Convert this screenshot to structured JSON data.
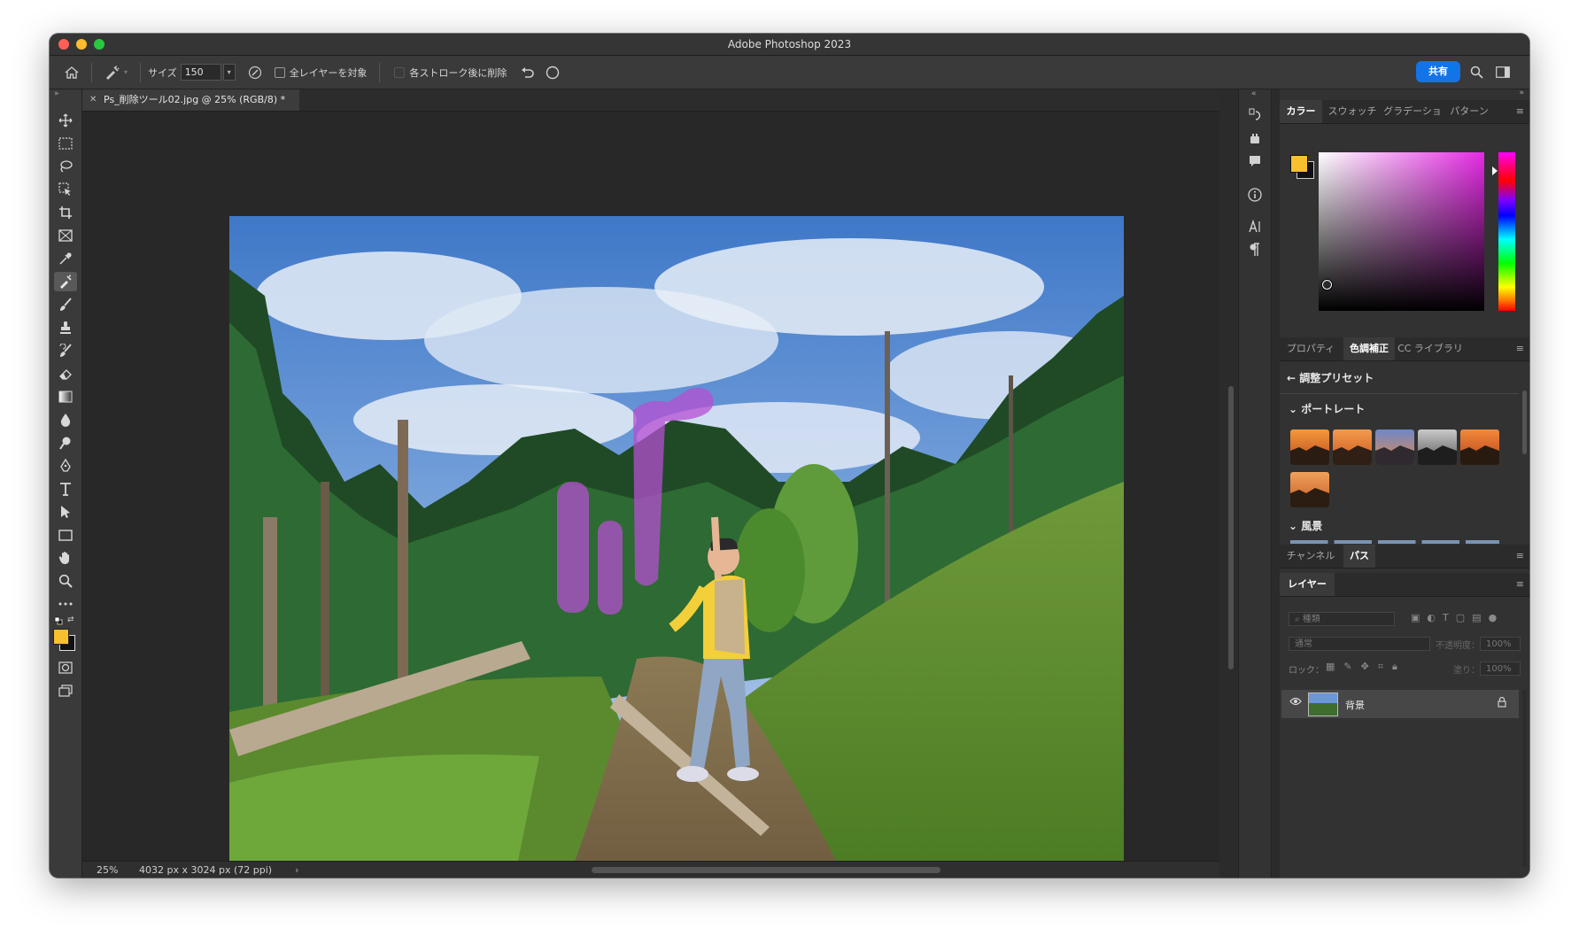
{
  "app": {
    "title": "Adobe Photoshop 2023"
  },
  "options": {
    "size_label": "サイズ",
    "size_value": "150",
    "all_layers_label": "全レイヤーを対象",
    "remove_after_stroke_label": "各ストローク後に削除",
    "share_label": "共有"
  },
  "document": {
    "tab_title": "Ps_削除ツール02.jpg @ 25% (RGB/8) *",
    "zoom": "25%",
    "dimensions": "4032 px x 3024 px (72 ppi)"
  },
  "color_panel": {
    "tabs": [
      "カラー",
      "スウォッチ",
      "グラデーショ",
      "パターン"
    ],
    "foreground": "#f8c02f",
    "background": "#111111"
  },
  "adjust_panel": {
    "tabs": [
      "プロパティ",
      "色調補正",
      "CC ライブラリ"
    ],
    "back_label": "調整プリセット",
    "group1": "ポートレート",
    "group2": "風景"
  },
  "channels_panel": {
    "tabs": [
      "チャンネル",
      "パス"
    ]
  },
  "layers_panel": {
    "tab": "レイヤー",
    "search_placeholder": "種類",
    "blend_mode": "通常",
    "opacity_label": "不透明度：",
    "opacity_value": "100%",
    "lock_label": "ロック：",
    "fill_label": "塗り：",
    "fill_value": "100%",
    "layer_name": "背景"
  },
  "colors": {
    "accent": "#1473e6",
    "highlight": "#b54fd1"
  }
}
